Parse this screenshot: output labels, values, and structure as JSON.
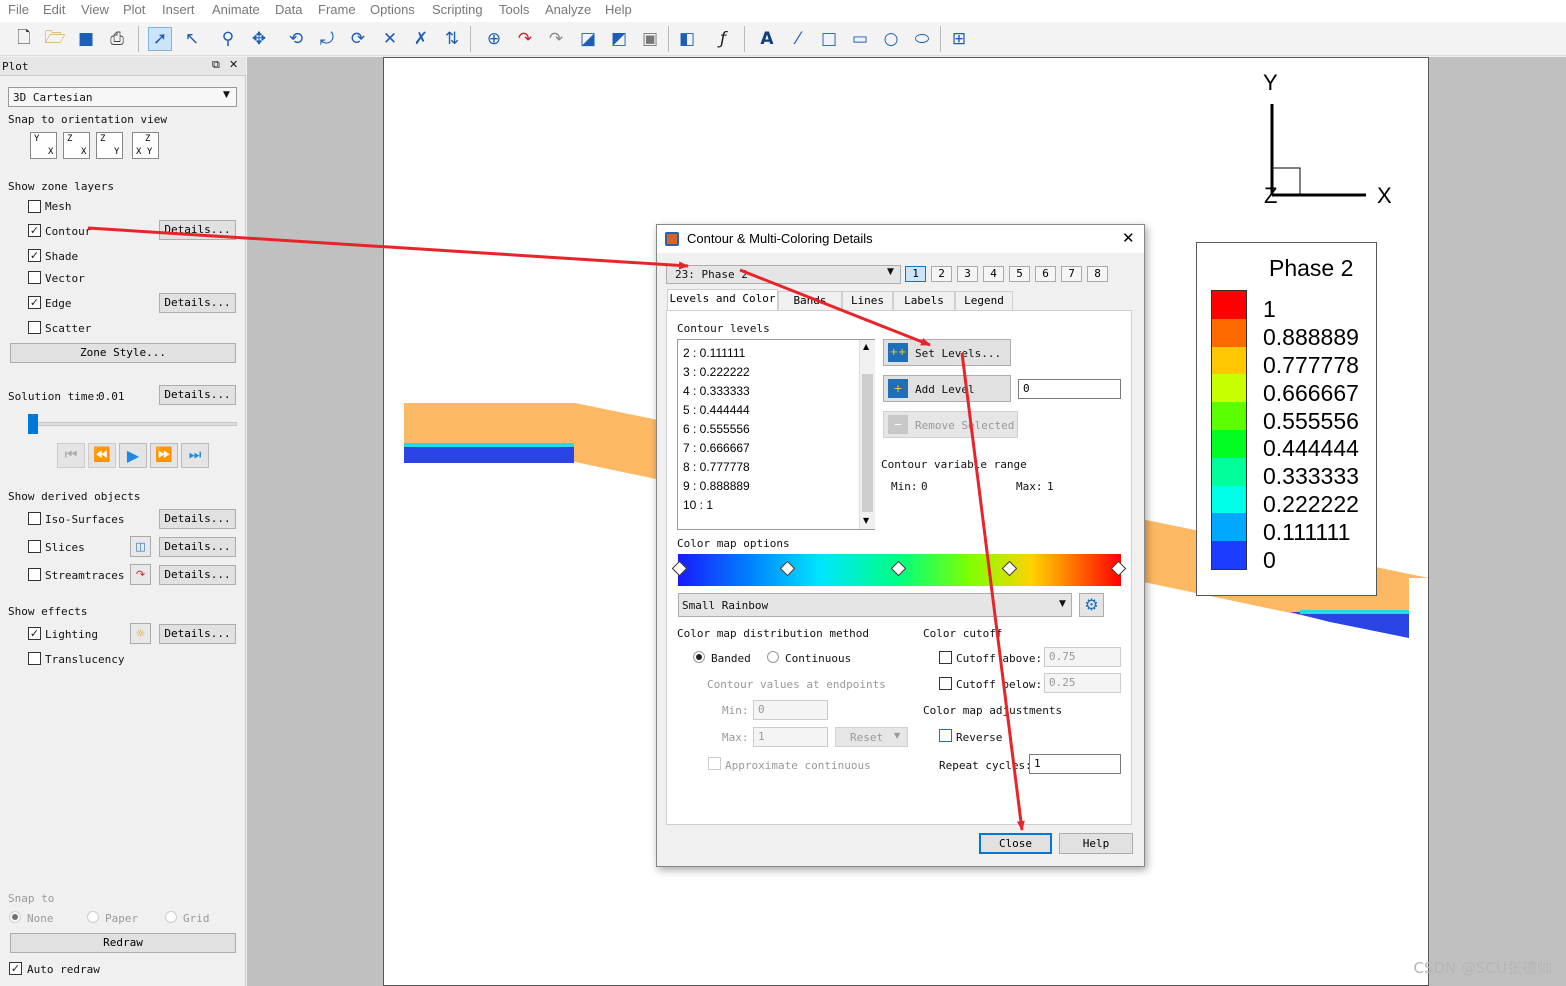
{
  "menu": [
    "File",
    "Edit",
    "View",
    "Plot",
    "Insert",
    "Animate",
    "Data",
    "Frame",
    "Options",
    "Scripting",
    "Tools",
    "Analyze",
    "Help"
  ],
  "panel": {
    "title": "Plot",
    "plot_type": "3D Cartesian",
    "snap_orientation_label": "Snap to orientation view",
    "orient_buttons": [
      [
        "Y",
        "X"
      ],
      [
        "Z",
        "X"
      ],
      [
        "Z",
        "Y"
      ],
      [
        "Z",
        "X Y"
      ]
    ],
    "zone_layers_label": "Show zone layers",
    "layers": {
      "mesh": {
        "label": "Mesh",
        "checked": false
      },
      "contour": {
        "label": "Contour",
        "checked": true
      },
      "shade": {
        "label": "Shade",
        "checked": true
      },
      "vector": {
        "label": "Vector",
        "checked": false
      },
      "edge": {
        "label": "Edge",
        "checked": true
      },
      "scatter": {
        "label": "Scatter",
        "checked": false
      }
    },
    "details_label": "Details...",
    "zone_style_label": "Zone Style...",
    "solution_time_label": "Solution time:",
    "solution_time_value": "0.01",
    "derived_label": "Show derived objects",
    "derived": {
      "iso": {
        "label": "Iso-Surfaces",
        "checked": false
      },
      "slices": {
        "label": "Slices",
        "checked": false
      },
      "streamtraces": {
        "label": "Streamtraces",
        "checked": false
      }
    },
    "effects_label": "Show effects",
    "effects": {
      "lighting": {
        "label": "Lighting",
        "checked": true
      },
      "translucency": {
        "label": "Translucency",
        "checked": false
      }
    },
    "snap_to_label": "Snap to",
    "snap_options": [
      "None",
      "Paper",
      "Grid"
    ],
    "redraw_label": "Redraw",
    "auto_redraw_label": "Auto redraw",
    "auto_redraw_checked": true
  },
  "axes": {
    "y": "Y",
    "x": "X",
    "z": "Z"
  },
  "legend": {
    "title": "Phase 2",
    "labels": [
      "1",
      "0.888889",
      "0.777778",
      "0.666667",
      "0.555556",
      "0.444444",
      "0.333333",
      "0.222222",
      "0.111111",
      "0"
    ],
    "colors": [
      "#ff0000",
      "#ff6a00",
      "#ffc800",
      "#c8ff00",
      "#5aff00",
      "#00ff20",
      "#00ff9a",
      "#00ffe8",
      "#00a8ff",
      "#1c3cff"
    ]
  },
  "dialog": {
    "title": "Contour & Multi-Coloring Details",
    "variable": "23: Phase 2",
    "group_tabs": [
      "1",
      "2",
      "3",
      "4",
      "5",
      "6",
      "7",
      "8"
    ],
    "active_group": "1",
    "tabs": [
      "Levels and Color",
      "Bands",
      "Lines",
      "Labels",
      "Legend"
    ],
    "active_tab": "Levels and Color",
    "contour_levels_label": "Contour levels",
    "levels": [
      "2 : 0.111111",
      "3 : 0.222222",
      "4 : 0.333333",
      "5 : 0.444444",
      "6 : 0.555556",
      "7 : 0.666667",
      "8 : 0.777778",
      "9 : 0.888889",
      "10 : 1"
    ],
    "set_levels_label": "Set Levels...",
    "add_level_label": "Add Level",
    "add_level_value": "0",
    "remove_selected_label": "Remove Selected",
    "range_label": "Contour variable range",
    "range_min_label": "Min:",
    "range_min": "0",
    "range_max_label": "Max:",
    "range_max": "1",
    "color_map_options_label": "Color map options",
    "color_map": "Small Rainbow",
    "distribution_label": "Color map distribution method",
    "banded_label": "Banded",
    "continuous_label": "Continuous",
    "endpoints_label": "Contour values at endpoints",
    "min_label": "Min:",
    "min_value": "0",
    "max_label": "Max:",
    "max_value": "1",
    "reset_label": "Reset",
    "approximate_label": "Approximate continuous",
    "cutoff_label": "Color cutoff",
    "cutoff_above_label": "Cutoff above:",
    "cutoff_above_value": "0.75",
    "cutoff_below_label": "Cutoff below:",
    "cutoff_below_value": "0.25",
    "adjustments_label": "Color map adjustments",
    "reverse_label": "Reverse",
    "repeat_label": "Repeat cycles:",
    "repeat_value": "1",
    "close_label": "Close",
    "help_label": "Help"
  },
  "watermark": "CSDN @SCU张德帅",
  "colors": {
    "arrow": "#e8242b",
    "geometry": "#fdb863",
    "low_phase": "#2a44e6",
    "selection": "#0078d7"
  }
}
